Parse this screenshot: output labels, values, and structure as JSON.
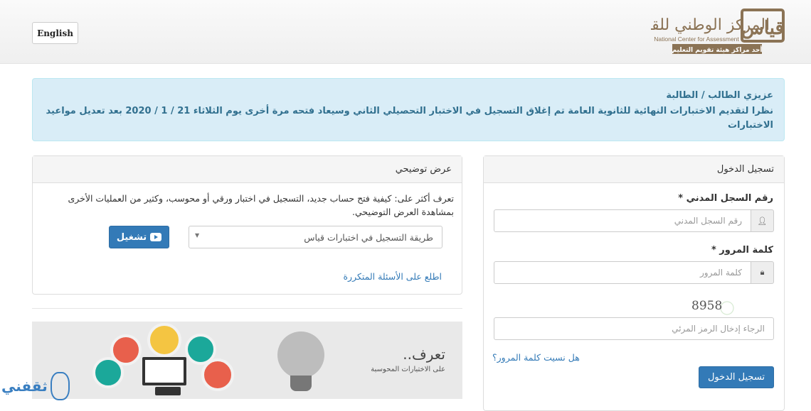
{
  "header": {
    "language_button": "English",
    "logo": {
      "arabic": "المركز الوطني للقياس",
      "english": "National Center for Assessment",
      "tagline": "أحد مراكز هيئة تقويم التعليم",
      "mark": "قياس"
    }
  },
  "alert": {
    "title": "عزيزي الطالب / الطالبة",
    "message": "نظرا لتقديم الاختبارات النهائية للثانوية العامة تم إغلاق التسجيل في الاختبار التحصيلي الثاني وسيعاد فتحه مرة أخرى يوم  الثلاثاء 21 / 1 / 2020 بعد تعديل مواعيد الاختبارات"
  },
  "demo": {
    "title": "عرض توضيحي",
    "description": "تعرف أكثر على: كيفية فتح حساب جديد، التسجيل في اختبار ورقي أو محوسب، وكثير من العمليات الأخرى بمشاهدة العرض التوضيحي.",
    "select_value": "طريقة التسجيل في اختبارات قياس",
    "play_button": "تشغيل",
    "faq_link": "اطلع على الأسئلة المتكررة"
  },
  "banner": {
    "title": "تعرف..",
    "subtitle": "على الاختبارات المحوسبة"
  },
  "login": {
    "title": "تسجيل الدخول",
    "id_label": "رقم السجل المدني *",
    "id_placeholder": "رقم السجل المدني",
    "password_label": "كلمة المرور *",
    "password_placeholder": "كلمة المرور",
    "captcha_text": "8958",
    "captcha_placeholder": "الرجاء إدخال الرمز المرئي",
    "forgot_link": "هل نسيت كلمة المرور؟",
    "submit_button": "تسجيل الدخول"
  },
  "watermark": "ثقفني",
  "colors": {
    "primary": "#337ab7",
    "alert_bg": "#d9edf7",
    "alert_text": "#31708f",
    "logo_brown": "#8b7355"
  }
}
